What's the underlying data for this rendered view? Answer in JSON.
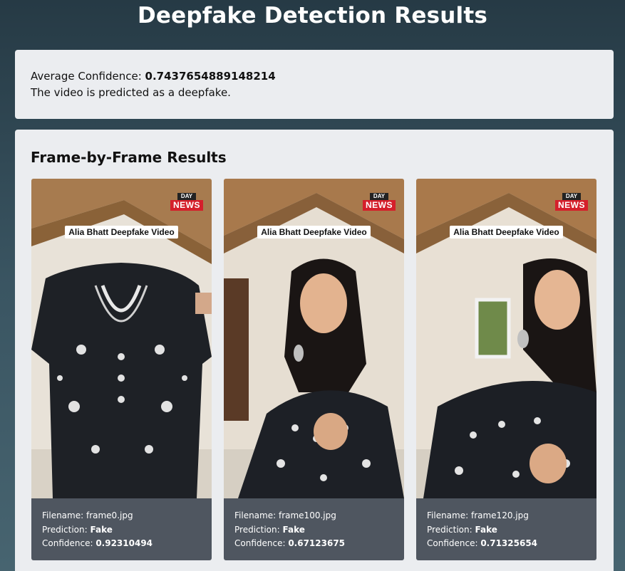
{
  "page": {
    "title": "Deepfake Detection Results"
  },
  "summary": {
    "avg_label": "Average Confidence: ",
    "avg_value": "0.7437654889148214",
    "verdict": "The video is predicted as a deepfake."
  },
  "frames_section": {
    "title": "Frame-by-Frame Results",
    "labels": {
      "filename": "Filename: ",
      "prediction": "Prediction: ",
      "confidence": "Confidence: "
    },
    "overlay": {
      "banner": "Alia Bhatt Deepfake Video",
      "logo_top": "DAY",
      "logo_bottom": "NEWS"
    },
    "frames": [
      {
        "filename": "frame0.jpg",
        "prediction": "Fake",
        "confidence": "0.92310494"
      },
      {
        "filename": "frame100.jpg",
        "prediction": "Fake",
        "confidence": "0.67123675"
      },
      {
        "filename": "frame120.jpg",
        "prediction": "Fake",
        "confidence": "0.71325654"
      }
    ]
  },
  "colors": {
    "card_bg": "#ebedf0",
    "info_bg": "#4f5660",
    "logo_red": "#d51f2b"
  }
}
